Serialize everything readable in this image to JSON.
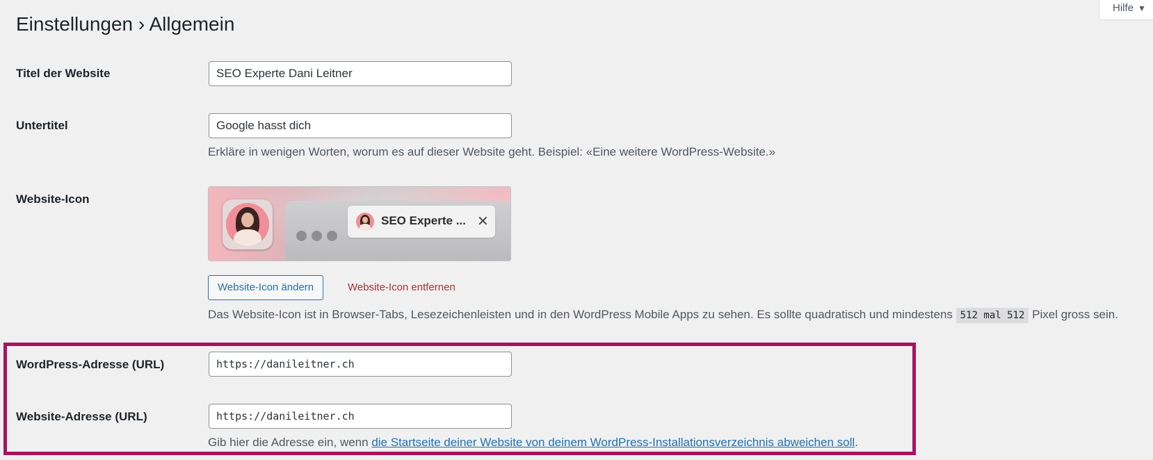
{
  "header": {
    "title": "Einstellungen › Allgemein",
    "help_label": "Hilfe"
  },
  "fields": {
    "site_title": {
      "label": "Titel der Website",
      "value": "SEO Experte Dani Leitner"
    },
    "tagline": {
      "label": "Untertitel",
      "value": "Google hasst dich",
      "description": "Erkläre in wenigen Worten, worum es auf dieser Website geht. Beispiel: «Eine weitere WordPress-Website.»"
    },
    "site_icon": {
      "label": "Website-Icon",
      "tab_title": "SEO Experte ...",
      "change_button": "Website-Icon ändern",
      "remove_button": "Website-Icon entfernen",
      "description_before": "Das Website-Icon ist in Browser-Tabs, Lesezeichenleisten und in den WordPress Mobile Apps zu sehen. Es sollte quadratisch und mindestens",
      "size_code": "512 mal 512",
      "description_after": "Pixel gross sein."
    },
    "wp_address": {
      "label": "WordPress-Adresse (URL)",
      "value": "https://danileitner.ch"
    },
    "site_address": {
      "label": "Website-Adresse (URL)",
      "value": "https://danileitner.ch",
      "description_before": "Gib hier die Adresse ein, wenn",
      "link_text": "die Startseite deiner Website von deinem WordPress-Installationsverzeichnis abweichen soll",
      "description_after": "."
    }
  },
  "colors": {
    "highlight": "#a8135e",
    "link": "#2271b1",
    "danger": "#b32d2e"
  }
}
